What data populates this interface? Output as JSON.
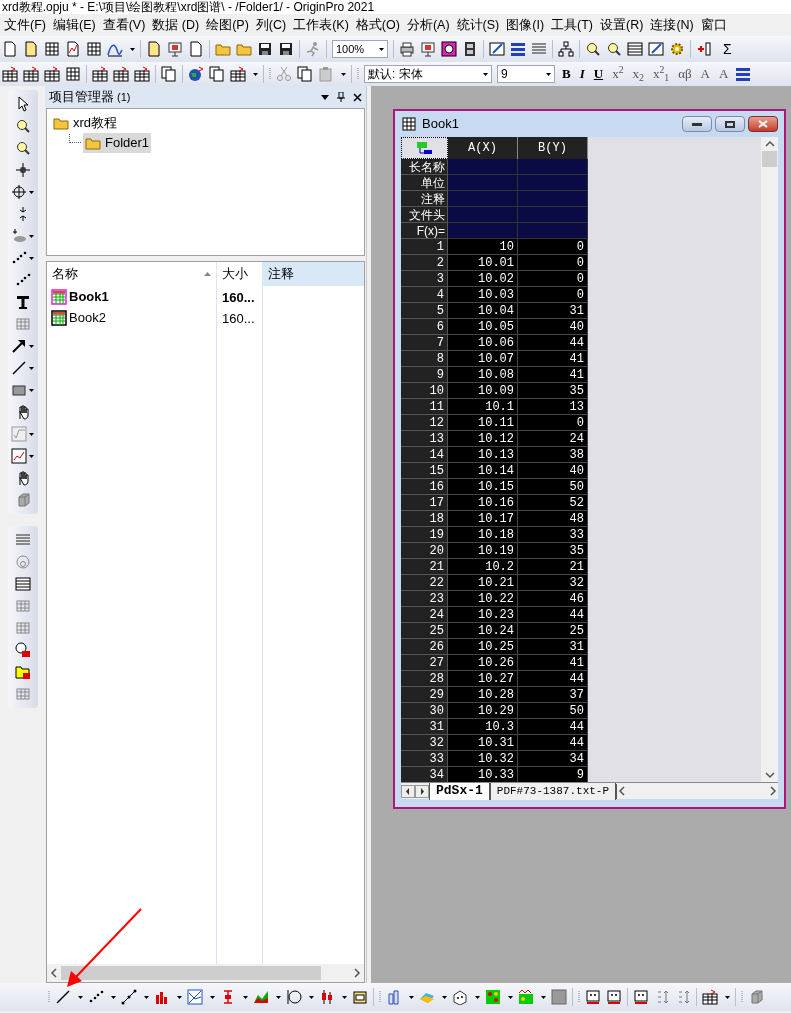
{
  "window": {
    "title": "xrd教程.opju * - E:\\项目\\绘图教程\\xrd图谱\\ - /Folder1/ - OriginPro 2021"
  },
  "menu": [
    "文件(F)",
    "编辑(E)",
    "查看(V)",
    "数据 (D)",
    "绘图(P)",
    "列(C)",
    "工作表(K)",
    "格式(O)",
    "分析(A)",
    "统计(S)",
    "图像(I)",
    "工具(T)",
    "设置(R)",
    "连接(N)",
    "窗口"
  ],
  "toolbar": {
    "zoom": "100%",
    "sum_label": "Σ",
    "font": "默认: 宋体",
    "font_size": "9",
    "format_buttons": [
      "B",
      "I",
      "U",
      "x$^{2}$",
      "x$_{2}$",
      "x$^{2}$$_{1}$",
      "αβ",
      "A",
      "A"
    ]
  },
  "project_manager": {
    "title": "项目管理器",
    "count": "(1)",
    "tree": [
      {
        "label": "xrd教程",
        "selected": false,
        "children": [
          {
            "label": "Folder1",
            "selected": true
          }
        ]
      }
    ],
    "columns": [
      {
        "label": "名称",
        "highlighted": false
      },
      {
        "label": "大小",
        "highlighted": false
      },
      {
        "label": "注释",
        "highlighted": true
      }
    ],
    "items": [
      {
        "name": "Book1",
        "size": "160...",
        "active": true
      },
      {
        "name": "Book2",
        "size": "160...",
        "active": false
      }
    ]
  },
  "workbook": {
    "title": "Book1",
    "columns": [
      "A(X)",
      "B(Y)"
    ],
    "label_rows": [
      "长名称",
      "单位",
      "注释",
      "文件头",
      "F(x)="
    ],
    "rows": [
      [
        "1",
        "10",
        "0"
      ],
      [
        "2",
        "10.01",
        "0"
      ],
      [
        "3",
        "10.02",
        "0"
      ],
      [
        "4",
        "10.03",
        "0"
      ],
      [
        "5",
        "10.04",
        "31"
      ],
      [
        "6",
        "10.05",
        "40"
      ],
      [
        "7",
        "10.06",
        "44"
      ],
      [
        "8",
        "10.07",
        "41"
      ],
      [
        "9",
        "10.08",
        "41"
      ],
      [
        "10",
        "10.09",
        "35"
      ],
      [
        "11",
        "10.1",
        "13"
      ],
      [
        "12",
        "10.11",
        "0"
      ],
      [
        "13",
        "10.12",
        "24"
      ],
      [
        "14",
        "10.13",
        "38"
      ],
      [
        "15",
        "10.14",
        "40"
      ],
      [
        "16",
        "10.15",
        "50"
      ],
      [
        "17",
        "10.16",
        "52"
      ],
      [
        "18",
        "10.17",
        "48"
      ],
      [
        "19",
        "10.18",
        "33"
      ],
      [
        "20",
        "10.19",
        "35"
      ],
      [
        "21",
        "10.2",
        "21"
      ],
      [
        "22",
        "10.21",
        "32"
      ],
      [
        "23",
        "10.22",
        "46"
      ],
      [
        "24",
        "10.23",
        "44"
      ],
      [
        "25",
        "10.24",
        "25"
      ],
      [
        "26",
        "10.25",
        "31"
      ],
      [
        "27",
        "10.26",
        "41"
      ],
      [
        "28",
        "10.27",
        "44"
      ],
      [
        "29",
        "10.28",
        "37"
      ],
      [
        "30",
        "10.29",
        "50"
      ],
      [
        "31",
        "10.3",
        "44"
      ],
      [
        "32",
        "10.31",
        "44"
      ],
      [
        "33",
        "10.32",
        "34"
      ],
      [
        "34",
        "10.33",
        "9"
      ]
    ],
    "sheets": [
      {
        "label": "PdSx-1",
        "selected": true
      },
      {
        "label": "PDF#73-1387.txt-P",
        "selected": false
      }
    ]
  }
}
